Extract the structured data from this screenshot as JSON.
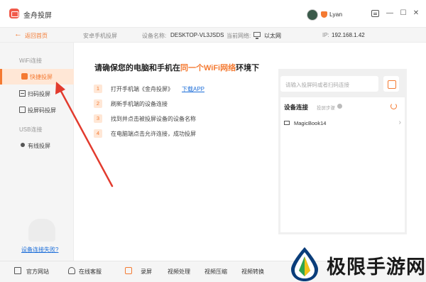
{
  "app": {
    "title": "金舟投屏"
  },
  "user": {
    "name": "Lyan"
  },
  "window_controls": {
    "minimize": "—",
    "maximize": "☐",
    "close": "✕"
  },
  "infobar": {
    "back_label": "返回首页",
    "section": "安卓手机投屏",
    "device_label": "设备名称:",
    "device_value": "DESKTOP-VL3JSDS",
    "network_label": "当前网络:",
    "network_value": "以太网",
    "ip_label": "IP:",
    "ip_value": "192.168.1.42"
  },
  "sidebar": {
    "wifi_section": "WiFi连接",
    "items": [
      {
        "label": "快捷投屏",
        "icon": "phone-icon",
        "active": true
      },
      {
        "label": "扫码投屏",
        "icon": "scan-icon"
      },
      {
        "label": "投屏码投屏",
        "icon": "screen-code-icon"
      }
    ],
    "usb_section": "USB连接",
    "usb_items": [
      {
        "label": "有线投屏",
        "icon": "usb-icon"
      }
    ],
    "help_link": "设备连接失败?"
  },
  "main": {
    "title_pre": "请确保您的电脑和手机在",
    "title_hl": "同一个WiFi网络",
    "title_post": "环境下",
    "steps": [
      {
        "num": "1",
        "text": "打开手机端《金舟投屏》",
        "link": "下载APP"
      },
      {
        "num": "2",
        "text": "刷新手机端的设备连接"
      },
      {
        "num": "3",
        "text": "找到并点击被投屏设备的设备名称"
      },
      {
        "num": "4",
        "text": "在电脑端点击允许连接，成功投屏"
      }
    ]
  },
  "panel": {
    "search_placeholder": "请输入投屏码或者扫码连接",
    "device_title": "设备连接",
    "device_sub": "投屏步骤",
    "devices": [
      {
        "name": "MagicBook14"
      }
    ]
  },
  "bottom": {
    "items": [
      {
        "label": "官方网站",
        "icon": "website-icon"
      },
      {
        "label": "在线客服",
        "icon": "service-icon"
      },
      {
        "label": "录屏",
        "icon": "record-icon"
      },
      {
        "label": "视频处理"
      },
      {
        "label": "视频压缩"
      },
      {
        "label": "视频转换"
      }
    ]
  },
  "watermark": {
    "text": "极限手游网"
  },
  "colors": {
    "accent": "#f47a32",
    "link": "#1e6fd9",
    "annotation_arrow": "#e23b2e"
  }
}
